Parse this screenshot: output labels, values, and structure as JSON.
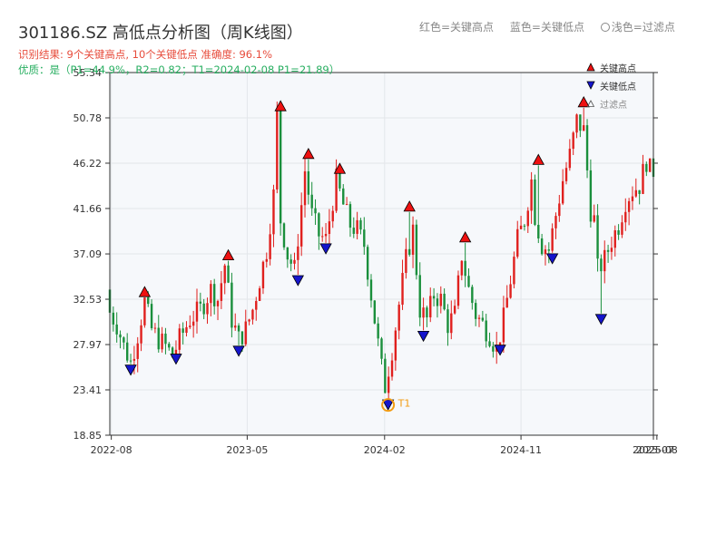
{
  "header": {
    "title": "301186.SZ 高低点分析图（周K线图）",
    "result_line": "识别结果: 9个关键高点, 10个关键低点   准确度: 96.1%",
    "quality_line": "优质：是（P1=44.9%，R2=0.82；T1=2024-02-08 P1=21.89）"
  },
  "top_legend": {
    "red": "红色=关键高点",
    "blue": "蓝色=关键低点",
    "light": "浅色=过滤点"
  },
  "legend": {
    "high": "关键高点",
    "low": "关键低点",
    "filtered": "过滤点"
  },
  "colors": {
    "up": "#e0201e",
    "down": "#1a8f3c",
    "high_marker": "#ee1111",
    "low_marker": "#1515cc",
    "t1_ring": "#f39c12",
    "plot_bg": "#f6f8fb",
    "grid": "#e3e6ea"
  },
  "chart_data": {
    "type": "candlestick",
    "title": "301186.SZ 高低点分析图（周K线图）",
    "y_ticks": [
      18.85,
      23.41,
      27.97,
      32.53,
      37.09,
      41.66,
      46.22,
      50.78,
      55.34
    ],
    "y_tick_labels": [
      "18.85",
      "23.41",
      "27.97",
      "32.53",
      "37.09",
      "41.66",
      "46.22",
      "50.78",
      "55.34"
    ],
    "ylim": [
      18.85,
      55.34
    ],
    "x_range": [
      "2022-07-29",
      "2025-07-25"
    ],
    "x_ticks": [
      "2022-08-01",
      "2023-05-01",
      "2024-02-01",
      "2024-11-01",
      "2025-07-25",
      "2025-08-01"
    ],
    "x_tick_labels": [
      "2022-08",
      "2023-05",
      "2024-02",
      "2024-11",
      "2025-07",
      "2025-08"
    ],
    "grid": true,
    "legend_position": "top-right",
    "t1": {
      "label": "T1",
      "date": "2024-02-08",
      "price": 21.89
    },
    "anchors": [
      [
        "2022-07-29",
        33.5
      ],
      [
        "2022-08-05",
        31.2
      ],
      [
        "2022-08-19",
        30.0
      ],
      [
        "2022-09-02",
        27.8
      ],
      [
        "2022-09-16",
        26.2
      ],
      [
        "2022-09-30",
        29.0
      ],
      [
        "2022-10-14",
        32.3
      ],
      [
        "2022-10-28",
        29.5
      ],
      [
        "2022-11-11",
        28.5
      ],
      [
        "2022-11-25",
        27.8
      ],
      [
        "2022-12-09",
        26.8
      ],
      [
        "2022-12-23",
        28.5
      ],
      [
        "2023-01-13",
        30.5
      ],
      [
        "2023-02-03",
        31.5
      ],
      [
        "2023-02-24",
        33.5
      ],
      [
        "2023-03-10",
        32.5
      ],
      [
        "2023-03-24",
        36.0
      ],
      [
        "2023-04-07",
        30.5
      ],
      [
        "2023-04-21",
        28.5
      ],
      [
        "2023-05-05",
        29.5
      ],
      [
        "2023-05-19",
        31.5
      ],
      [
        "2023-06-02",
        34.5
      ],
      [
        "2023-06-16",
        37.5
      ],
      [
        "2023-06-30",
        43.0
      ],
      [
        "2023-07-07",
        51.0
      ],
      [
        "2023-07-14",
        40.5
      ],
      [
        "2023-07-28",
        37.0
      ],
      [
        "2023-08-11",
        35.5
      ],
      [
        "2023-08-25",
        42.0
      ],
      [
        "2023-09-01",
        45.5
      ],
      [
        "2023-09-15",
        41.0
      ],
      [
        "2023-09-29",
        39.0
      ],
      [
        "2023-10-13",
        38.5
      ],
      [
        "2023-10-27",
        42.5
      ],
      [
        "2023-11-03",
        44.5
      ],
      [
        "2023-11-17",
        42.0
      ],
      [
        "2023-12-01",
        40.0
      ],
      [
        "2023-12-15",
        39.5
      ],
      [
        "2023-12-29",
        38.0
      ],
      [
        "2024-01-12",
        33.0
      ],
      [
        "2024-01-26",
        28.0
      ],
      [
        "2024-02-08",
        23.5
      ],
      [
        "2024-02-23",
        27.5
      ],
      [
        "2024-03-08",
        32.0
      ],
      [
        "2024-03-22",
        36.5
      ],
      [
        "2024-04-05",
        39.5
      ],
      [
        "2024-04-19",
        31.5
      ],
      [
        "2024-05-03",
        30.5
      ],
      [
        "2024-05-17",
        33.0
      ],
      [
        "2024-05-31",
        32.5
      ],
      [
        "2024-06-14",
        30.0
      ],
      [
        "2024-06-28",
        31.0
      ],
      [
        "2024-07-12",
        37.0
      ],
      [
        "2024-07-26",
        33.5
      ],
      [
        "2024-08-09",
        31.0
      ],
      [
        "2024-08-23",
        30.0
      ],
      [
        "2024-09-06",
        29.0
      ],
      [
        "2024-09-20",
        27.5
      ],
      [
        "2024-10-04",
        30.5
      ],
      [
        "2024-10-18",
        34.5
      ],
      [
        "2024-11-01",
        38.5
      ],
      [
        "2024-11-15",
        40.5
      ],
      [
        "2024-11-29",
        44.5
      ],
      [
        "2024-12-06",
        41.0
      ],
      [
        "2024-12-20",
        38.0
      ],
      [
        "2025-01-03",
        37.5
      ],
      [
        "2025-01-17",
        41.0
      ],
      [
        "2025-01-31",
        44.5
      ],
      [
        "2025-02-14",
        47.0
      ],
      [
        "2025-02-28",
        50.5
      ],
      [
        "2025-03-14",
        49.5
      ],
      [
        "2025-03-28",
        41.5
      ],
      [
        "2025-04-04",
        40.5
      ],
      [
        "2025-04-11",
        35.5
      ],
      [
        "2025-04-25",
        36.5
      ],
      [
        "2025-05-09",
        38.5
      ],
      [
        "2025-05-23",
        40.0
      ],
      [
        "2025-06-06",
        42.5
      ],
      [
        "2025-06-20",
        43.5
      ],
      [
        "2025-07-04",
        44.0
      ],
      [
        "2025-07-18",
        46.5
      ],
      [
        "2025-07-25",
        45.5
      ]
    ],
    "key_highs": [
      {
        "date": "2022-10-07",
        "price": 32.7
      },
      {
        "date": "2023-03-24",
        "price": 36.4
      },
      {
        "date": "2023-07-07",
        "price": 51.4
      },
      {
        "date": "2023-09-01",
        "price": 46.6
      },
      {
        "date": "2023-11-03",
        "price": 45.1
      },
      {
        "date": "2024-03-22",
        "price": 41.3
      },
      {
        "date": "2024-07-12",
        "price": 38.2
      },
      {
        "date": "2024-12-06",
        "price": 46.0
      },
      {
        "date": "2025-03-07",
        "price": 51.8
      }
    ],
    "key_lows": [
      {
        "date": "2022-09-09",
        "price": 26.0
      },
      {
        "date": "2022-12-09",
        "price": 27.1
      },
      {
        "date": "2023-04-14",
        "price": 27.9
      },
      {
        "date": "2023-08-11",
        "price": 35.0
      },
      {
        "date": "2023-10-06",
        "price": 38.2
      },
      {
        "date": "2024-02-08",
        "price": 22.5
      },
      {
        "date": "2024-04-19",
        "price": 29.4
      },
      {
        "date": "2024-09-20",
        "price": 28.0
      },
      {
        "date": "2025-01-03",
        "price": 37.2
      },
      {
        "date": "2025-04-11",
        "price": 31.1
      }
    ]
  }
}
